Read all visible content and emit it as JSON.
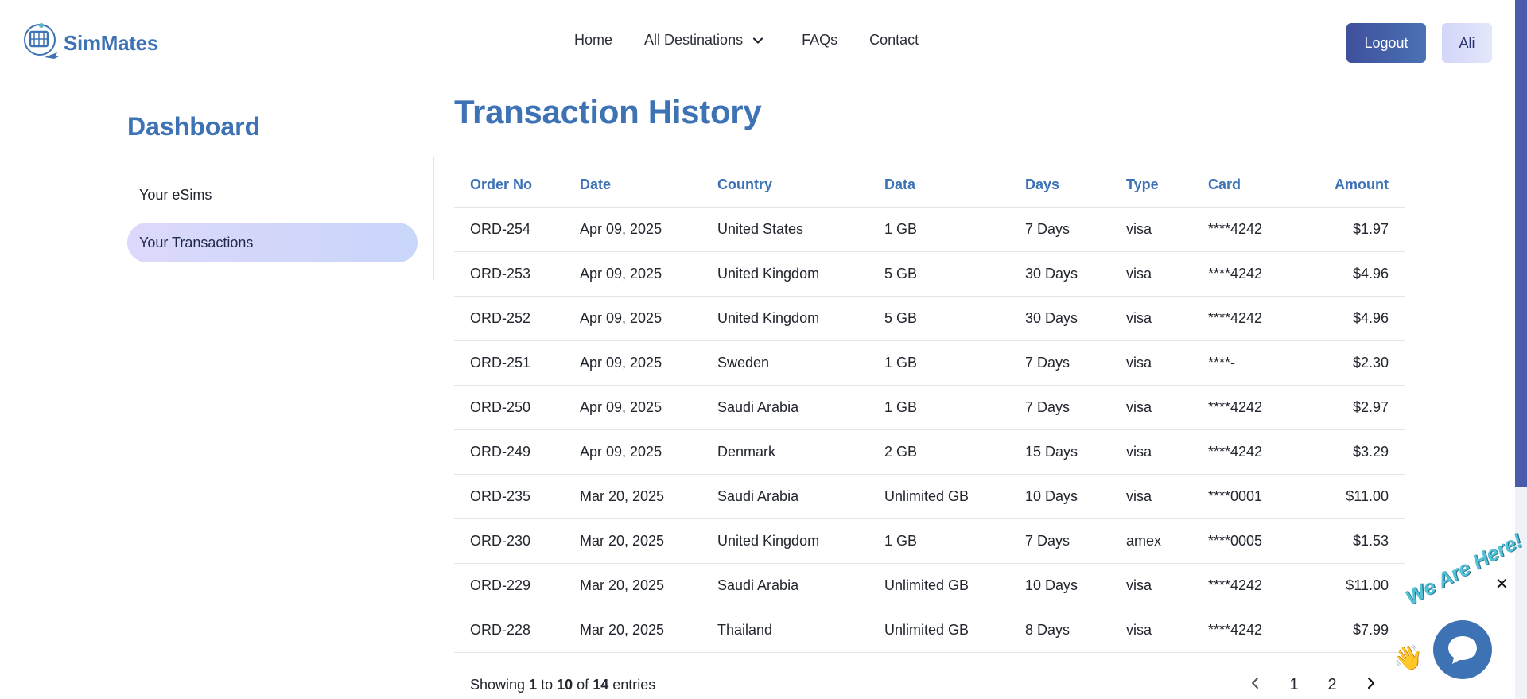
{
  "brand": {
    "name": "SimMates"
  },
  "nav": {
    "items": [
      "Home",
      "All Destinations",
      "FAQs",
      "Contact"
    ]
  },
  "header": {
    "logout_label": "Logout",
    "user_label": "Ali"
  },
  "sidebar": {
    "title": "Dashboard",
    "items": [
      {
        "label": "Your eSims"
      },
      {
        "label": "Your Transactions"
      }
    ]
  },
  "main": {
    "title": "Transaction History",
    "columns": [
      "Order No",
      "Date",
      "Country",
      "Data",
      "Days",
      "Type",
      "Card",
      "Amount"
    ],
    "rows": [
      [
        "ORD-254",
        "Apr 09, 2025",
        "United States",
        "1 GB",
        "7 Days",
        "visa",
        "****4242",
        "$1.97"
      ],
      [
        "ORD-253",
        "Apr 09, 2025",
        "United Kingdom",
        "5 GB",
        "30 Days",
        "visa",
        "****4242",
        "$4.96"
      ],
      [
        "ORD-252",
        "Apr 09, 2025",
        "United Kingdom",
        "5 GB",
        "30 Days",
        "visa",
        "****4242",
        "$4.96"
      ],
      [
        "ORD-251",
        "Apr 09, 2025",
        "Sweden",
        "1 GB",
        "7 Days",
        "visa",
        "****-",
        "$2.30"
      ],
      [
        "ORD-250",
        "Apr 09, 2025",
        "Saudi Arabia",
        "1 GB",
        "7 Days",
        "visa",
        "****4242",
        "$2.97"
      ],
      [
        "ORD-249",
        "Apr 09, 2025",
        "Denmark",
        "2 GB",
        "15 Days",
        "visa",
        "****4242",
        "$3.29"
      ],
      [
        "ORD-235",
        "Mar 20, 2025",
        "Saudi Arabia",
        "Unlimited GB",
        "10 Days",
        "visa",
        "****0001",
        "$11.00"
      ],
      [
        "ORD-230",
        "Mar 20, 2025",
        "United Kingdom",
        "1 GB",
        "7 Days",
        "amex",
        "****0005",
        "$1.53"
      ],
      [
        "ORD-229",
        "Mar 20, 2025",
        "Saudi Arabia",
        "Unlimited GB",
        "10 Days",
        "visa",
        "****4242",
        "$11.00"
      ],
      [
        "ORD-228",
        "Mar 20, 2025",
        "Thailand",
        "Unlimited GB",
        "8 Days",
        "visa",
        "****4242",
        "$7.99"
      ]
    ],
    "footer": {
      "showing": "Showing",
      "from": "1",
      "to_word": "to",
      "to": "10",
      "of_word": "of",
      "total": "14",
      "entries_word": "entries"
    },
    "pagination": {
      "pages": [
        "1",
        "2"
      ]
    }
  },
  "chat": {
    "label": "We Are Here!",
    "close": "✕"
  },
  "icons": [
    "logo-icon",
    "chevron-down-icon",
    "chevron-left-icon",
    "chevron-right-icon",
    "close-icon",
    "chat-icon",
    "wave-hand-icon"
  ],
  "colors": {
    "accent": "#3d72b4",
    "logout_bg": "#3f4f9c",
    "active_pill": "#c9d6fa"
  }
}
